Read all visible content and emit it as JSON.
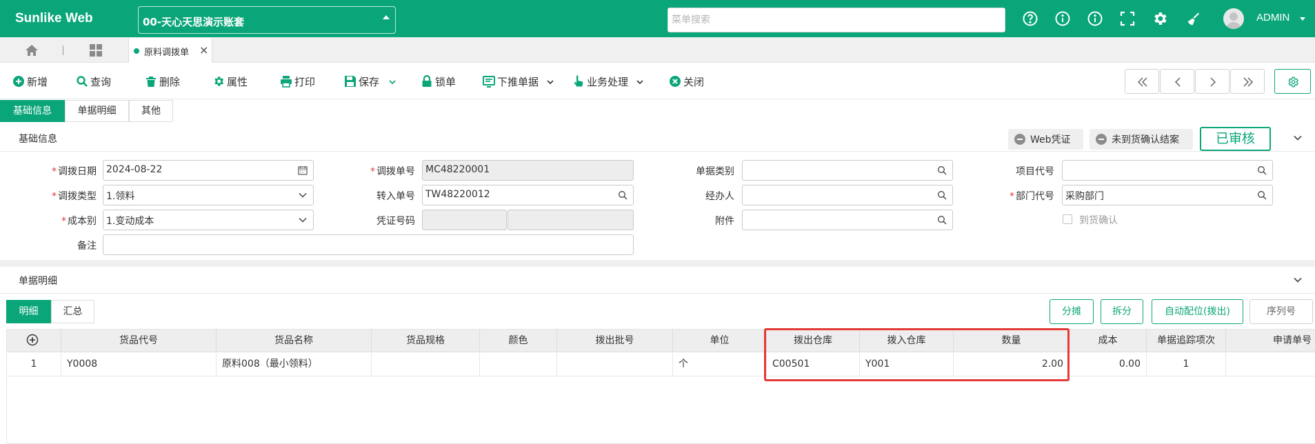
{
  "header": {
    "brand": "Sunlike Web",
    "account": "00-天心天思演示账套",
    "search_placeholder": "菜单搜索",
    "icons": [
      "help-icon",
      "info-icon",
      "info-icon",
      "fullscreen-icon",
      "gear-icon",
      "clean-icon"
    ],
    "user": "ADMIN"
  },
  "tabs": {
    "active_doc": "原料调拨单"
  },
  "toolbar": {
    "add": "新增",
    "query": "查询",
    "delete": "删除",
    "props": "属性",
    "print": "打印",
    "save": "保存",
    "lock": "锁单",
    "push": "下推单据",
    "business": "业务处理",
    "close": "关闭"
  },
  "section_tabs": [
    "基础信息",
    "单据明细",
    "其他"
  ],
  "basic": {
    "title": "基础信息",
    "web_voucher": "Web凭证",
    "unconfirmed": "未到货确认结案",
    "status": "已审核"
  },
  "form": {
    "date_label": "调拨日期",
    "date_value": "2024-08-22",
    "type_label": "调拨类型",
    "type_value": "1.领料",
    "cost_label": "成本别",
    "cost_value": "1.变动成本",
    "remark_label": "备注",
    "no_label": "调拨单号",
    "no_value": "MC48220001",
    "in_label": "转入单号",
    "in_value": "TW48220012",
    "voucher_label": "凭证号码",
    "doc_type_label": "单据类别",
    "handler_label": "经办人",
    "attach_label": "附件",
    "project_label": "项目代号",
    "dept_label": "部门代号",
    "dept_value": "采购部门",
    "confirm_label": "到货确认"
  },
  "detail": {
    "title": "单据明细",
    "subtabs": [
      "明细",
      "汇总"
    ],
    "buttons": {
      "split_share": "分摊",
      "split": "拆分",
      "auto": "自动配位(拨出)",
      "serial": "序列号"
    },
    "columns": [
      "货品代号",
      "货品名称",
      "货品规格",
      "颜色",
      "拨出批号",
      "单位",
      "拨出仓库",
      "拨入仓库",
      "数量",
      "成本",
      "单据追踪项次",
      "申请单号"
    ],
    "rows": [
      {
        "no": "1",
        "code": "Y0008",
        "name": "原料008（最小领料）",
        "spec": "",
        "color": "",
        "batch": "",
        "unit": "个",
        "out_wh": "C00501",
        "in_wh": "Y001",
        "qty": "2.00",
        "cost": "0.00",
        "trace": "1",
        "apply": ""
      }
    ]
  },
  "colors": {
    "brand": "#0aa679",
    "highlight": "#e53935"
  }
}
